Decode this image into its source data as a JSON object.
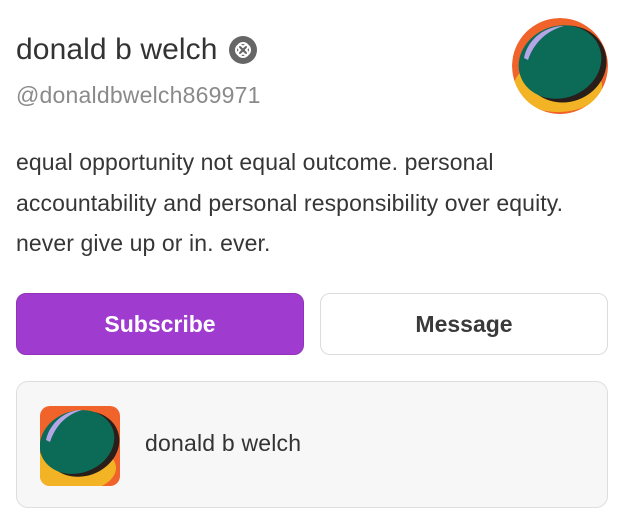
{
  "profile": {
    "display_name": "donald b welch",
    "handle": "@donaldbwelch869971",
    "badge_icon": "verified-badge-icon",
    "bio": "equal opportunity not equal outcome. personal accountability and personal responsibility over equity. never give up or in. ever."
  },
  "actions": {
    "subscribe_label": "Subscribe",
    "message_label": "Message"
  },
  "publication": {
    "name": "donald b welch"
  },
  "colors": {
    "accent": "#a03bd0",
    "avatar_green": "#0b6b57",
    "avatar_orange": "#f0632a",
    "avatar_yellow": "#f2b324",
    "avatar_lavender": "#b6a6e8"
  }
}
